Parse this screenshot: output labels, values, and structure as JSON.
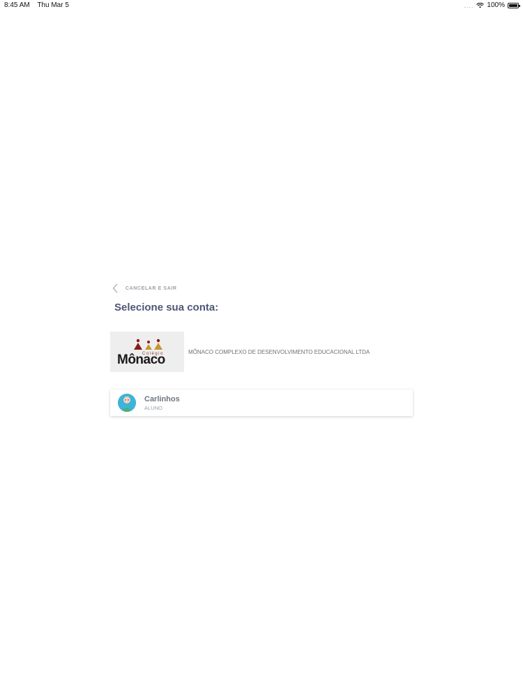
{
  "status_bar": {
    "time": "8:45 AM",
    "date": "Thu Mar 5",
    "signal": "....",
    "battery": "100%"
  },
  "back": {
    "label": "CANCELAR E SAIR"
  },
  "title": "Selecione sua conta:",
  "school": {
    "logo_text": "Mônaco",
    "logo_subtext": "Colégio",
    "name": "MÔNACO COMPLEXO DE DESENVOLVIMENTO EDUCACIONAL LTDA"
  },
  "accounts": [
    {
      "name": "Carlinhos",
      "role": "ALUNO",
      "avatar_color": "#3fb3d9"
    }
  ],
  "colors": {
    "title": "#4e5677",
    "muted": "#9aa0a6",
    "logo_red": "#8b1a1a",
    "logo_gold": "#c8962e"
  }
}
